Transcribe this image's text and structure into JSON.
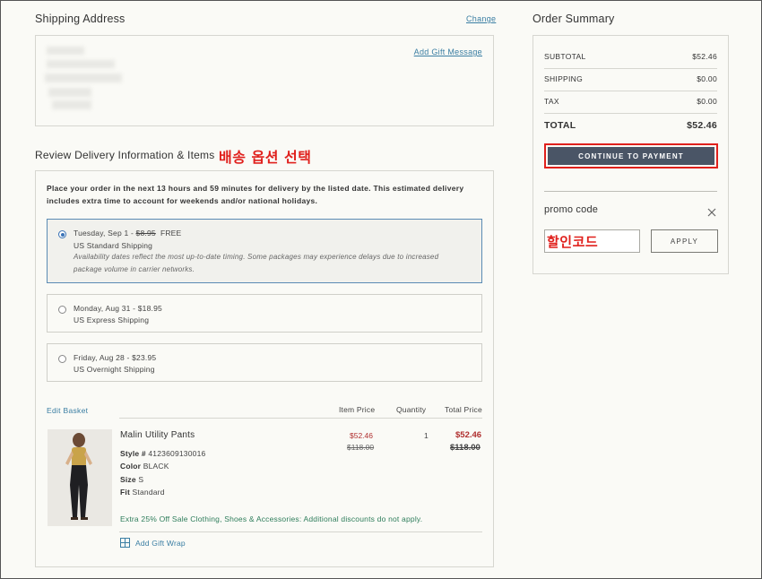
{
  "shipping_address": {
    "title": "Shipping Address",
    "change_link": "Change",
    "gift_message_link": "Add Gift Message"
  },
  "review": {
    "title": "Review Delivery Information & Items",
    "annotation": "배송 옵션 선택",
    "notice": "Place your order in the next 13 hours and 59 minutes for delivery by the listed date. This estimated delivery includes extra time to account for weekends and/or national holidays.",
    "options": [
      {
        "date": "Tuesday, Sep 1 - ",
        "old_price": "$8.95",
        "price": "FREE",
        "method": "US Standard Shipping",
        "note": "Availability dates reflect the most up-to-date timing. Some packages may experience delays due to increased package volume in carrier networks.",
        "selected": true
      },
      {
        "date": "Monday, Aug 31 - $18.95",
        "method": "US Express Shipping",
        "selected": false
      },
      {
        "date": "Friday, Aug 28 - $23.95",
        "method": "US Overnight Shipping",
        "selected": false
      }
    ]
  },
  "basket": {
    "edit_link": "Edit Basket",
    "col_item_price": "Item Price",
    "col_quantity": "Quantity",
    "col_total_price": "Total Price",
    "item": {
      "name": "Malin Utility Pants",
      "style_label": "Style #",
      "style_value": "4123609130016",
      "color_label": "Color",
      "color_value": "BLACK",
      "size_label": "Size",
      "size_value": "S",
      "fit_label": "Fit",
      "fit_value": "Standard",
      "item_price": "$52.46",
      "item_old_price": "$118.00",
      "quantity": "1",
      "total_price": "$52.46",
      "total_old_price": "$118.00",
      "promo_text": "Extra 25% Off Sale Clothing, Shoes & Accessories: Additional discounts do not apply.",
      "gift_wrap": "Add Gift Wrap"
    }
  },
  "summary": {
    "title": "Order Summary",
    "subtotal_label": "SUBTOTAL",
    "subtotal_value": "$52.46",
    "shipping_label": "SHIPPING",
    "shipping_value": "$0.00",
    "tax_label": "TAX",
    "tax_value": "$0.00",
    "total_label": "TOTAL",
    "total_value": "$52.46",
    "continue_button": "CONTINUE TO PAYMENT",
    "promo_label": "promo code",
    "promo_annotation": "할인코드",
    "apply_button": "APPLY"
  },
  "colors": {
    "accent_button": "#4a5566",
    "annotation_red": "#e0201c",
    "sale_red": "#b02f2f",
    "link_blue": "#3a7ea3",
    "promo_green": "#2e7d5b"
  },
  "icons": [
    "close-icon",
    "gift-icon",
    "radio-icon"
  ]
}
